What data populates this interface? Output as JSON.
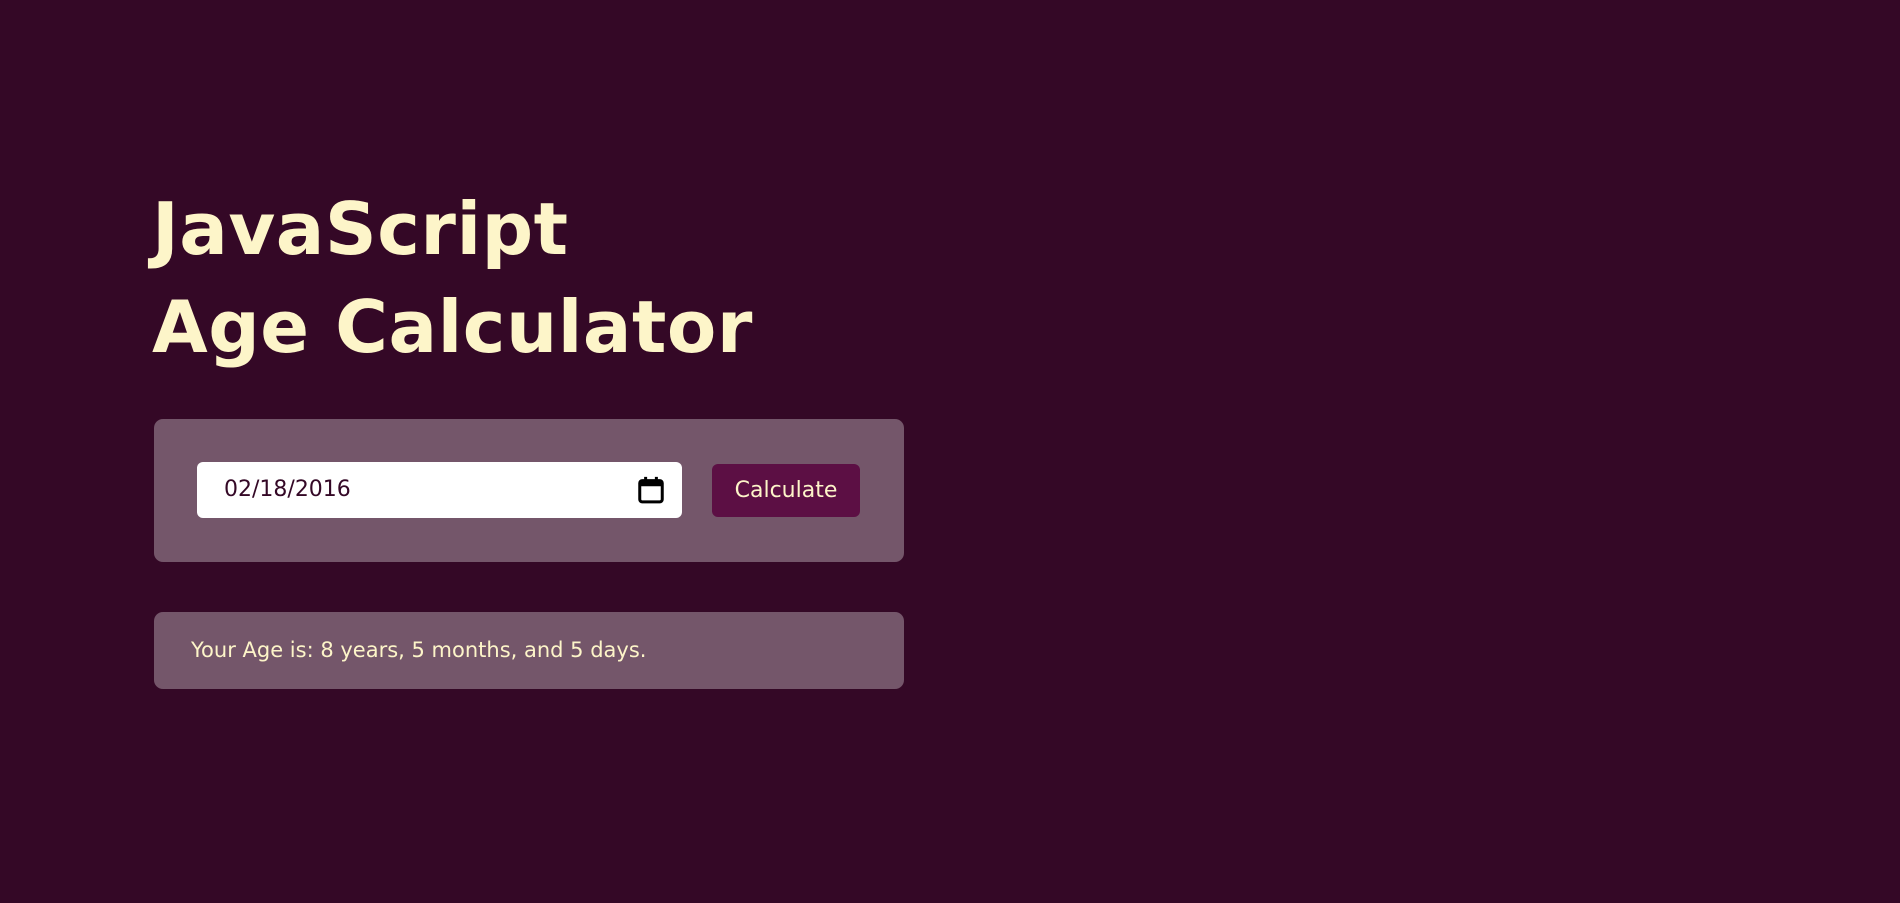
{
  "title": {
    "line1": "JavaScript",
    "line2": "Age Calculator"
  },
  "form": {
    "date_value": "02/18/2016",
    "calendar_icon": "calendar-icon",
    "button_label": "Calculate"
  },
  "result": {
    "text": "Your Age is: 8 years, 5 months, and 5 days."
  },
  "colors": {
    "background": "#340826",
    "panel": "#74566a",
    "accent_button": "#5c0f44",
    "text": "#fdf5c9"
  }
}
